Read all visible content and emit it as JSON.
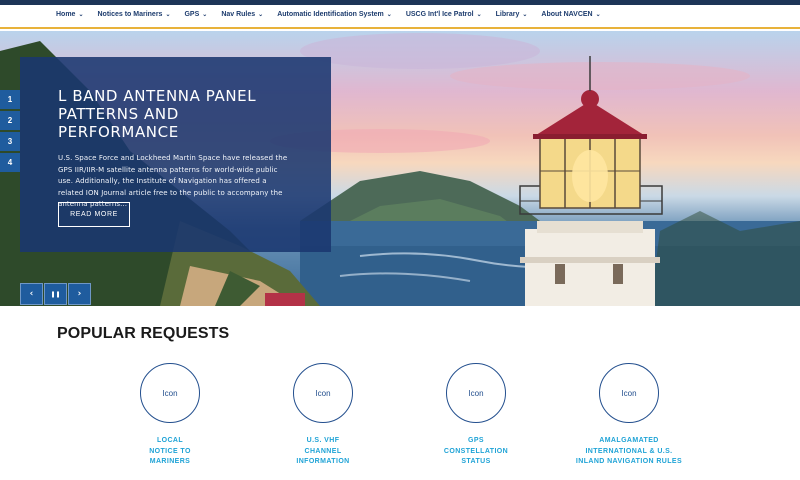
{
  "nav": {
    "items": [
      {
        "label": "Home"
      },
      {
        "label": "Notices to Mariners"
      },
      {
        "label": "GPS"
      },
      {
        "label": "Nav Rules"
      },
      {
        "label": "Automatic Identification System"
      },
      {
        "label": "USCG Int'l Ice Patrol"
      },
      {
        "label": "Library"
      },
      {
        "label": "About NAVCEN"
      }
    ]
  },
  "hero": {
    "slide_numbers": [
      "1",
      "2",
      "3",
      "4"
    ],
    "title": "L BAND ANTENNA PANEL PATTERNS AND PERFORMANCE",
    "body": "U.S. Space Force and Lockheed Martin Space have released the GPS IIR/IIR-M satellite antenna patterns for world-wide public use.  Additionally, the Institute of Navigation has offered a related ION Journal article free to the public to accompany the antenna patterns...",
    "read_more": "READ MORE",
    "controls": {
      "prev": "‹",
      "pause": "❚❚",
      "next": "›"
    }
  },
  "popular": {
    "title": "POPULAR REQUESTS",
    "cards": [
      {
        "icon_text": "Icon",
        "label": "LOCAL\nNOTICE TO\nMARINERS"
      },
      {
        "icon_text": "Icon",
        "label": "U.S. VHF\nCHANNEL\nINFORMATION"
      },
      {
        "icon_text": "Icon",
        "label": "GPS\nCONSTELLATION\nSTATUS"
      },
      {
        "icon_text": "Icon",
        "label": "AMALGAMATED\nINTERNATIONAL & U.S.\nINLAND NAVIGATION RULES"
      }
    ]
  },
  "colors": {
    "navy": "#1d3c6e",
    "accent_gold": "#e8b23a",
    "caption_bg": "#1a3770",
    "card_label": "#1fa3d6"
  }
}
